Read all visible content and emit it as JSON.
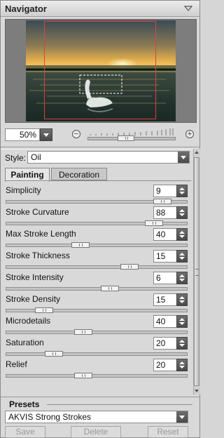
{
  "navigator": {
    "title": "Navigator",
    "zoom_value": "50%",
    "zoom_slider_fraction": 0.42
  },
  "style": {
    "label": "Style:",
    "value": "Oil"
  },
  "tabs": [
    {
      "label": "Painting",
      "active": true
    },
    {
      "label": "Decoration",
      "active": false
    }
  ],
  "params": [
    {
      "label": "Simplicity",
      "value": "9",
      "fraction": 0.9
    },
    {
      "label": "Stroke Curvature",
      "value": "88",
      "fraction": 0.85
    },
    {
      "label": "Max Stroke Length",
      "value": "40",
      "fraction": 0.4
    },
    {
      "label": "Stroke Thickness",
      "value": "15",
      "fraction": 0.7
    },
    {
      "label": "Stroke Intensity",
      "value": "6",
      "fraction": 0.58
    },
    {
      "label": "Stroke Density",
      "value": "15",
      "fraction": 0.18
    },
    {
      "label": "Microdetails",
      "value": "40",
      "fraction": 0.42
    },
    {
      "label": "Saturation",
      "value": "20",
      "fraction": 0.24
    },
    {
      "label": "Relief",
      "value": "20",
      "fraction": 0.42
    }
  ],
  "presets": {
    "title": "Presets",
    "selected": "AKVIS Strong Strokes",
    "save_label": "Save",
    "delete_label": "Delete",
    "reset_label": "Reset"
  }
}
